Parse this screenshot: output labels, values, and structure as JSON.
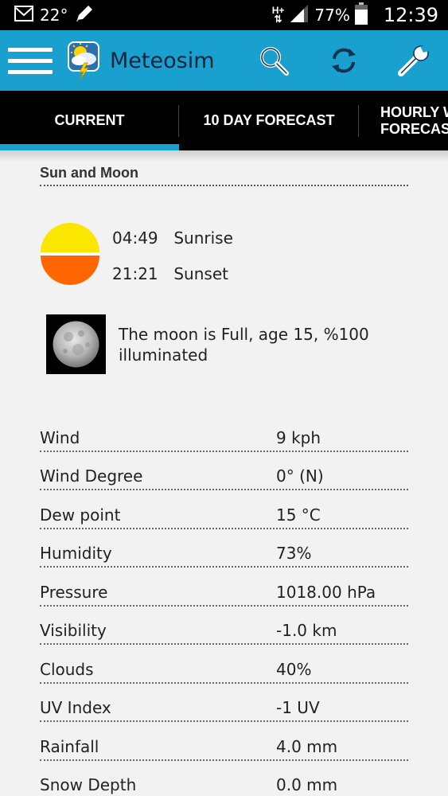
{
  "status_bar": {
    "temperature": "22°",
    "network_type_top": "H+",
    "network_arrows": "⇅",
    "battery": "77%",
    "time": "12:39"
  },
  "app_bar": {
    "title": "Meteosim",
    "icons": [
      "menu-icon",
      "weather-logo-icon",
      "search-icon",
      "refresh-icon",
      "wrench-icon"
    ],
    "color": "#1aa0cf"
  },
  "tabs": [
    {
      "label": "CURRENT"
    },
    {
      "label": "10 DAY FORECAST"
    },
    {
      "label_line1": "HOURLY W",
      "label_line2": "FORECAST"
    }
  ],
  "sun_moon": {
    "title": "Sun and Moon",
    "sunrise_time": "04:49",
    "sunrise_label": "Sunrise",
    "sunset_time": "21:21",
    "sunset_label": "Sunset",
    "moon_text": "The moon is Full, age 15, %100 illuminated"
  },
  "details": [
    {
      "label": "Wind",
      "value": "9 kph"
    },
    {
      "label": "Wind Degree",
      "value": "0° (N)"
    },
    {
      "label": "Dew point",
      "value": "15 °C"
    },
    {
      "label": "Humidity",
      "value": "73%"
    },
    {
      "label": "Pressure",
      "value": "1018.00 hPa"
    },
    {
      "label": "Visibility",
      "value": "-1.0 km"
    },
    {
      "label": "Clouds",
      "value": "40%"
    },
    {
      "label": "UV Index",
      "value": "-1 UV"
    },
    {
      "label": "Rainfall",
      "value": "4.0 mm"
    },
    {
      "label": "Snow Depth",
      "value": "0.0 mm"
    }
  ]
}
